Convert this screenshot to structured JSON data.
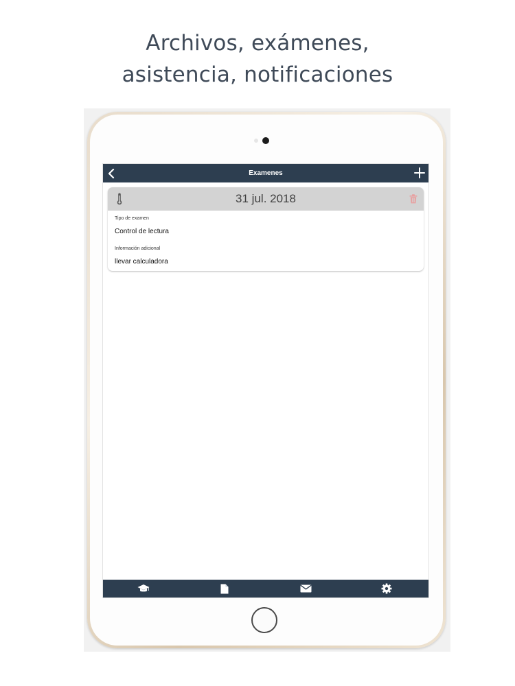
{
  "headline": {
    "line1": "Archivos, exámenes,",
    "line2": "asistencia, notificaciones"
  },
  "navbar": {
    "title": "Examenes",
    "back_icon": "chevron-left-icon",
    "add_icon": "plus-icon"
  },
  "exam_card": {
    "date": "31 jul. 2018",
    "status_icon": "thermometer-icon",
    "delete_icon": "trash-icon",
    "fields": [
      {
        "label": "Tipo de examen",
        "value": "Control de lectura"
      },
      {
        "label": "Información adicional",
        "value": "llevar calculadora"
      }
    ]
  },
  "tabbar": {
    "tabs": [
      {
        "icon": "graduation-cap-icon"
      },
      {
        "icon": "document-icon"
      },
      {
        "icon": "envelope-icon"
      },
      {
        "icon": "gear-icon"
      }
    ]
  },
  "colors": {
    "bar": "#2d3e50",
    "card_header": "#d3d3d3",
    "delete_accent": "#e8a0a0",
    "headline_text": "#3f4a58"
  }
}
